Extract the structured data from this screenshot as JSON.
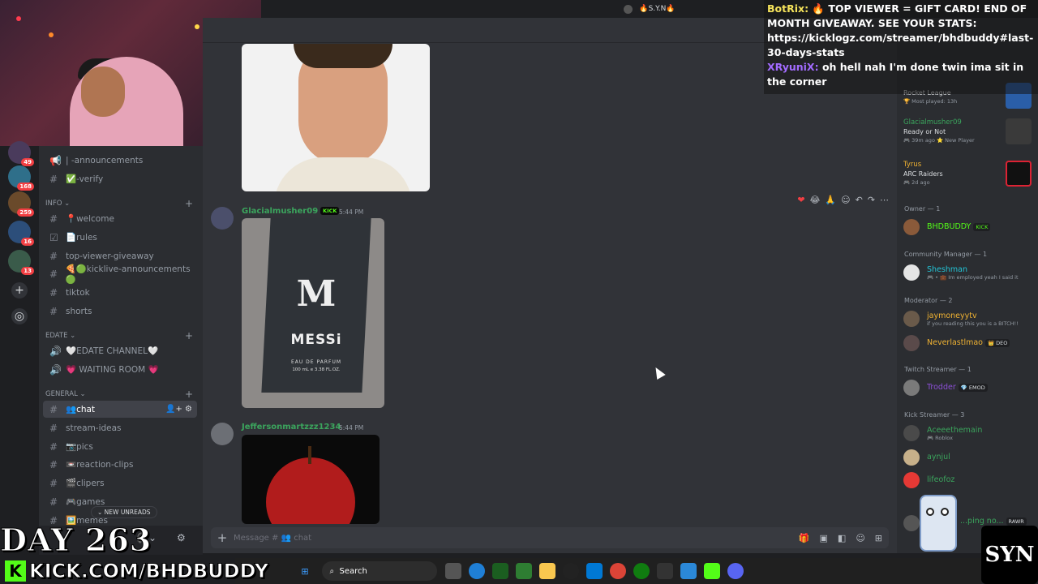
{
  "window": {
    "server_title": "🔥S.Y.N🔥"
  },
  "colors": {
    "accent": "#5865f2",
    "kick_green": "#53fc18",
    "danger": "#f23f43",
    "bg_main": "#313338",
    "bg_sidebar": "#2b2d31"
  },
  "rail": {
    "badges": [
      "49",
      "168",
      "259",
      "16",
      "13"
    ]
  },
  "channels": {
    "items_top": [
      {
        "name": "| -announcements",
        "icon": "megaphone-icon"
      },
      {
        "name": "✅-verify",
        "icon": "hash-icon"
      }
    ],
    "categories": {
      "info": "INFO",
      "edate": "EDATE",
      "general": "GENERAL"
    },
    "info_items": [
      {
        "name": "📍welcome"
      },
      {
        "name": "📄rules"
      },
      {
        "name": "top-viewer-giveaway"
      },
      {
        "name": "🍕🟢kicklive-announcements🟢"
      },
      {
        "name": "tiktok"
      },
      {
        "name": "shorts"
      }
    ],
    "edate_items": [
      {
        "name": "🤍EDATE CHANNEL🤍"
      },
      {
        "name": "💗 WAITING ROOM 💗"
      }
    ],
    "general_items": [
      {
        "name": "👥chat"
      },
      {
        "name": "stream-ideas"
      },
      {
        "name": "📷pics"
      },
      {
        "name": "📼reaction-clips"
      },
      {
        "name": "🎬clipers"
      },
      {
        "name": "🎮games"
      },
      {
        "name": "🖼️memes"
      }
    ],
    "new_unreads": "NEW UNREADS"
  },
  "messages": [
    {
      "author": "Glacialmusher09",
      "tag": "KICK",
      "time": "5:44 PM",
      "image_text": "MESSi",
      "image_sub": "EAU DE PARFUM",
      "image_sub2": "100 mL e 3.38 FL.OZ."
    },
    {
      "author": "Jeffersonmartzzz1234",
      "time": "5:44 PM"
    }
  ],
  "input": {
    "placeholder": "Message # 👥 chat"
  },
  "members": {
    "activities": [
      {
        "name": "",
        "game": "Rocket League",
        "meta": "🏆 Most played: 13h"
      },
      {
        "name": "Glacialmusher09",
        "game": "Ready or Not",
        "meta": "🎮 39m ago  ⭐ New Player"
      },
      {
        "name": "Tyrus",
        "game": "ARC Raiders",
        "meta": "🎮 2d ago"
      }
    ],
    "groups": [
      {
        "label": "Owner — 1"
      },
      {
        "label": "Community Manager — 1"
      },
      {
        "label": "Moderator — 2"
      },
      {
        "label": "Twitch Streamer — 1"
      },
      {
        "label": "Kick Streamer — 3"
      }
    ],
    "people": [
      {
        "name": "BHDBUDDY",
        "tag": "KICK",
        "sub": "",
        "color": "#53fc18"
      },
      {
        "name": "Sheshman",
        "tag": "",
        "sub": "🎮 • 💼 Im employed yeah I said it",
        "color": "#23c4d6"
      },
      {
        "name": "jaymoneyytv",
        "tag": "",
        "sub": "if you reading this you is a BITCH!!",
        "color": "#f0b232"
      },
      {
        "name": "Neverlastlmao",
        "tag": "👑 DEO",
        "sub": "",
        "color": "#f0b232"
      },
      {
        "name": "Trodder",
        "tag": "💎 EMOD",
        "sub": "",
        "color": "#8b4fd6"
      },
      {
        "name": "Aceeethemain",
        "tag": "",
        "sub": "🎮 Roblox",
        "color": "#3ba55d"
      },
      {
        "name": "aynjul",
        "tag": "",
        "sub": "",
        "color": "#3ba55d"
      },
      {
        "name": "lifeofoz",
        "tag": "",
        "sub": "",
        "color": "#3ba55d"
      },
      {
        "name": "...ping no...",
        "tag": "RAWR",
        "sub": "",
        "color": "#3ba55d"
      }
    ]
  },
  "stream_chat": [
    {
      "user": "BotRix:",
      "text": "🔥 TOP VIEWER = GIFT CARD! END OF MONTH GIVEAWAY. SEE YOUR STATS: https://kicklogz.com/streamer/bhdbuddy#last-30-days-stats"
    },
    {
      "user": "XRyuniX:",
      "text": "oh hell nah I'm done twin ima sit in the corner"
    }
  ],
  "overlay": {
    "day": "DAY 263",
    "kick_url": "KICK.COM/BHDBUDDY",
    "logo": "SYN"
  },
  "taskbar": {
    "search": "Search"
  }
}
